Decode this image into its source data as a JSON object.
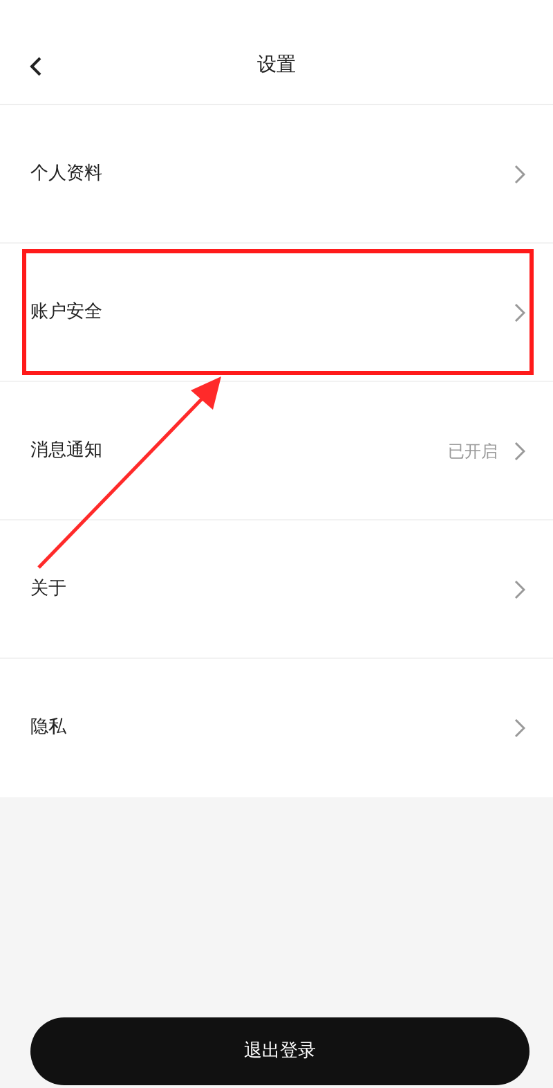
{
  "header": {
    "title": "设置"
  },
  "rows": [
    {
      "label": "个人资料"
    },
    {
      "label": "账户安全"
    },
    {
      "label": "消息通知",
      "value": "已开启"
    },
    {
      "label": "关于"
    },
    {
      "label": "隐私"
    }
  ],
  "logout_button": {
    "label": "退出登录"
  }
}
